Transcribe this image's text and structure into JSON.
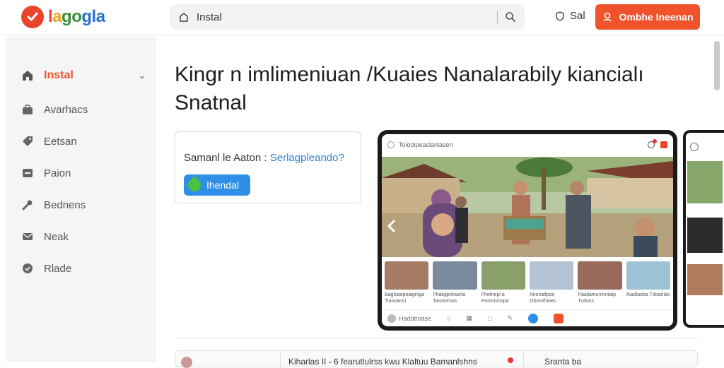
{
  "brand": {
    "name_parts": [
      "l",
      "a",
      "go",
      "gla"
    ],
    "accent": "#f0532b"
  },
  "search": {
    "value": "Instal",
    "placeholder": "Instal"
  },
  "header": {
    "user_label": "Sal",
    "cta_label": "Ombhe Ineenan"
  },
  "sidebar": {
    "items": [
      {
        "label": "Instal",
        "icon": "home-icon",
        "active": true
      },
      {
        "label": "Avarhacs",
        "icon": "bag-icon",
        "active": false
      },
      {
        "label": "Eetsan",
        "icon": "tag-icon",
        "active": false
      },
      {
        "label": "Paion",
        "icon": "list-icon",
        "active": false
      },
      {
        "label": "Bednens",
        "icon": "wrench-icon",
        "active": false
      },
      {
        "label": "Neak",
        "icon": "mail-icon",
        "active": false
      },
      {
        "label": "Rlade",
        "icon": "badge-icon",
        "active": false
      }
    ]
  },
  "main": {
    "title_line1": "Kingr n imlimeniuan /Kuaies Nanalarabily kiancialı",
    "title_line2": "Snatnal",
    "card": {
      "question_prefix": "Samanl le Aaton :",
      "question_link": "Serlagpleando?",
      "button_label": "Ihendal"
    }
  },
  "tablet": {
    "top_label": "Toioolpeaslanlasen",
    "thumb_captions": [
      "Bagloaopoaigniga Tianoansi",
      "Fhakgpriloanla Tasntomos",
      "Fhetnepl a Pomnisnopa",
      "Anonaltpsa Ofonnihioes",
      "Paaliamuninniatp Tuduss",
      "Aiadlaeba Tdoanlas"
    ],
    "bottom_search": "Haddeoase"
  },
  "bottom": {
    "left_text": "Kiharlas II - 6 fearutlulrss kwu Klaltuu Bamanlshns",
    "right_text": "Sranta ba"
  }
}
